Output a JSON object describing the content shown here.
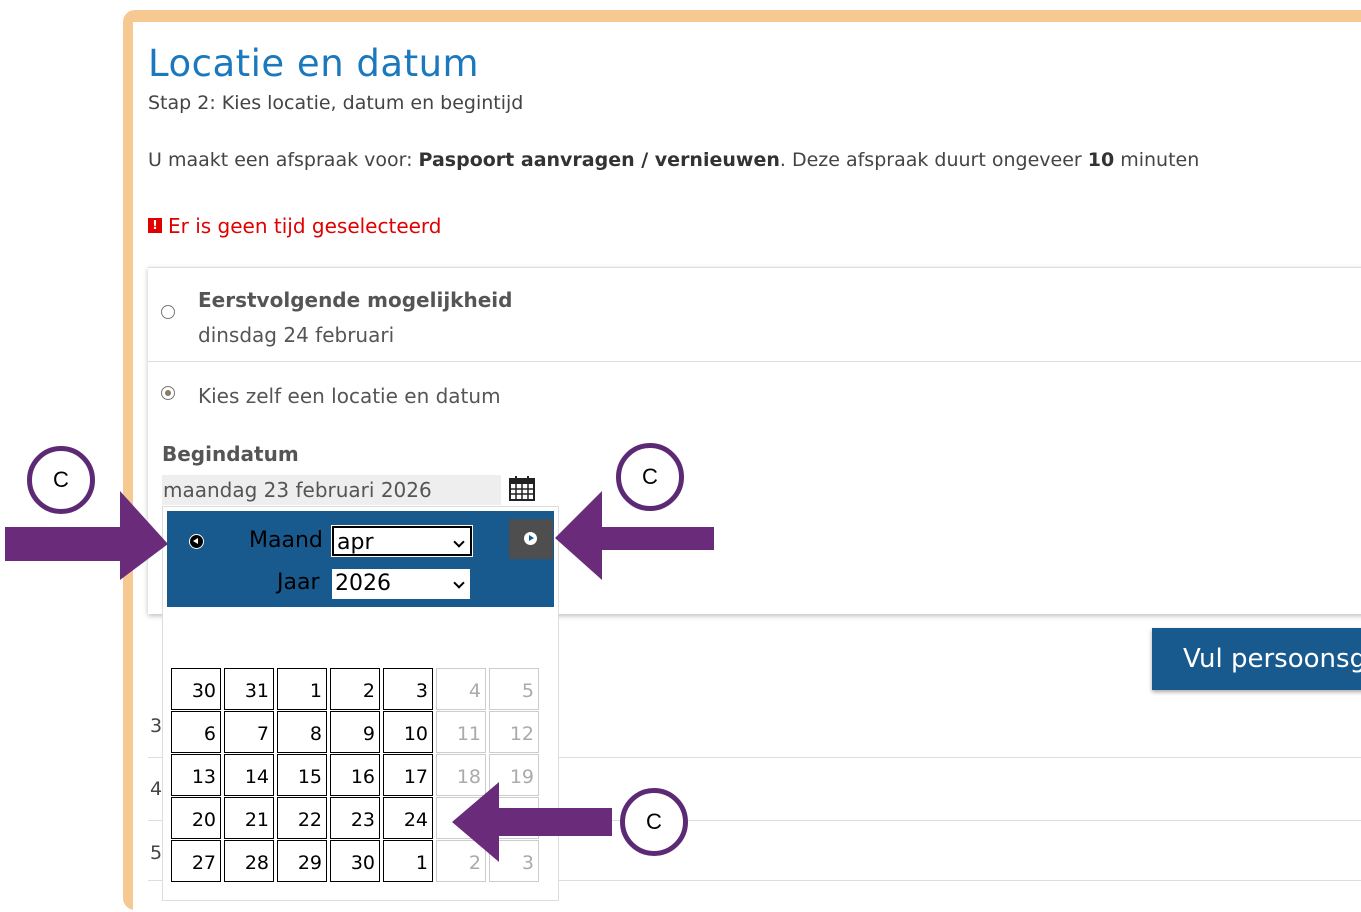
{
  "page": {
    "title": "Locatie en datum",
    "subtitle": "Stap 2: Kies locatie, datum en begintijd",
    "intro_prefix": "U maakt een afspraak voor: ",
    "intro_product": "Paspoort aanvragen / vernieuwen",
    "intro_middle": ". Deze afspraak duurt ongeveer ",
    "intro_duration": "10",
    "intro_suffix": " minuten",
    "error_icon": "!",
    "error_text": "Er is geen tijd geselecteerd"
  },
  "options": {
    "first_title": "Eerstvolgende mogelijkheid",
    "first_date": "dinsdag 24 februari",
    "first_checked": false,
    "own_label": "Kies zelf een locatie en datum",
    "own_checked": true
  },
  "begindatum": {
    "label": "Begindatum",
    "value": "maandag 23 februari 2026",
    "icon": "calendar-icon"
  },
  "picker": {
    "month_label": "Maand",
    "month_value": "apr",
    "year_label": "Jaar",
    "year_value": "2026",
    "weeks": [
      [
        {
          "d": "30",
          "dim": false
        },
        {
          "d": "31",
          "dim": false
        },
        {
          "d": "1",
          "dim": false
        },
        {
          "d": "2",
          "dim": false
        },
        {
          "d": "3",
          "dim": false
        },
        {
          "d": "4",
          "dim": true
        },
        {
          "d": "5",
          "dim": true
        }
      ],
      [
        {
          "d": "6",
          "dim": false
        },
        {
          "d": "7",
          "dim": false
        },
        {
          "d": "8",
          "dim": false
        },
        {
          "d": "9",
          "dim": false
        },
        {
          "d": "10",
          "dim": false
        },
        {
          "d": "11",
          "dim": true
        },
        {
          "d": "12",
          "dim": true
        }
      ],
      [
        {
          "d": "13",
          "dim": false
        },
        {
          "d": "14",
          "dim": false
        },
        {
          "d": "15",
          "dim": false
        },
        {
          "d": "16",
          "dim": false
        },
        {
          "d": "17",
          "dim": false
        },
        {
          "d": "18",
          "dim": true
        },
        {
          "d": "19",
          "dim": true
        }
      ],
      [
        {
          "d": "20",
          "dim": false
        },
        {
          "d": "21",
          "dim": false
        },
        {
          "d": "22",
          "dim": false
        },
        {
          "d": "23",
          "dim": false
        },
        {
          "d": "24",
          "dim": false
        },
        {
          "d": "",
          "dim": true
        },
        {
          "d": "",
          "dim": true
        }
      ],
      [
        {
          "d": "27",
          "dim": false
        },
        {
          "d": "28",
          "dim": false
        },
        {
          "d": "29",
          "dim": false
        },
        {
          "d": "30",
          "dim": false
        },
        {
          "d": "1",
          "dim": false
        },
        {
          "d": "2",
          "dim": true
        },
        {
          "d": "3",
          "dim": true
        }
      ]
    ]
  },
  "rows": [
    "3",
    "4",
    "5"
  ],
  "submit_label": "Vul persoonsg",
  "annotation_letter": "C",
  "colors": {
    "frame": "#f6c892",
    "title": "#1a78be",
    "error": "#e10000",
    "picker_header": "#195a8e",
    "arrow": "#6a2c7a"
  }
}
